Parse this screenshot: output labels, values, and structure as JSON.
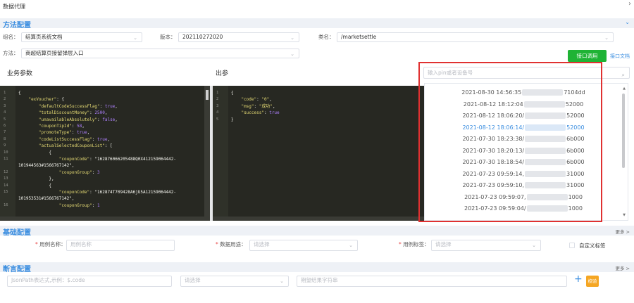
{
  "page_title": "数据代理",
  "sections": {
    "method": "方法配置",
    "base": "基础配置",
    "assert": "断言配置"
  },
  "form": {
    "group_label": "组名：",
    "group_value": "结算页系统文档",
    "version_label": "版本：",
    "version_value": "202110272020",
    "class_label": "类名：",
    "class_value": "/marketsettle",
    "method_label": "方法：",
    "method_value": "商超结算页接留弹层入口",
    "call_btn": "接口调用",
    "doc_link": "接口文档"
  },
  "params_title": "业务参数",
  "output_title": "出参",
  "search": {
    "placeholder": "输入pin或者设备号"
  },
  "dropdown_items": [
    {
      "time": "2021-08-30 14:56:35",
      "suffix": "7104dd",
      "active": false
    },
    {
      "time": "2021-08-12 18:12:04",
      "suffix": "52000",
      "active": false
    },
    {
      "time": "2021-08-12 18:06:20/",
      "suffix": "52000",
      "active": false
    },
    {
      "time": "2021-08-12 18:06:14/",
      "suffix": "52000",
      "active": true
    },
    {
      "time": "2021-07-30 18:23:38/",
      "suffix": "6b000",
      "active": false
    },
    {
      "time": "2021-07-30 18:20:13/",
      "suffix": "6b000",
      "active": false
    },
    {
      "time": "2021-07-30 18:18:54/",
      "suffix": "6b000",
      "active": false
    },
    {
      "time": "2021-07-23 09:59:14,",
      "suffix": "31000",
      "active": false
    },
    {
      "time": "2021-07-23 09:59:10,",
      "suffix": "31000",
      "active": false
    },
    {
      "time": "2021-07-23 09:59:07,",
      "suffix": "1000",
      "active": false
    },
    {
      "time": "2021-07-23 09:59:04/",
      "suffix": "1000",
      "active": false
    }
  ],
  "code_left": [
    {
      "n": "1",
      "t": "{"
    },
    {
      "n": "2",
      "t": "    \"exVoucher\": {"
    },
    {
      "n": "3",
      "t": "        \"defaultCodeSuccessFlag\": true,"
    },
    {
      "n": "4",
      "t": "        \"totalDiscountMoney\": 2500,"
    },
    {
      "n": "5",
      "t": "        \"unavailableAbsolutely\": false,"
    },
    {
      "n": "6",
      "t": "        \"couponTipId\": 58,"
    },
    {
      "n": "7",
      "t": "        \"promoteType\": true,"
    },
    {
      "n": "8",
      "t": "        \"codeListSuccessFlag\": true,"
    },
    {
      "n": "9",
      "t": "        \"actualSelectedCouponList\": ["
    },
    {
      "n": "10",
      "t": "            {"
    },
    {
      "n": "11",
      "t": "                \"couponCode\": \"162876066205488Q0X412159064442-"
    },
    {
      "n": "",
      "t": "101944563#1566767142\","
    },
    {
      "n": "12",
      "t": "                \"couponGroup\": 3"
    },
    {
      "n": "13",
      "t": "            },"
    },
    {
      "n": "14",
      "t": "            {"
    },
    {
      "n": "15",
      "t": "                \"couponCode\": \"162874T709428A6jU5A12159064442-"
    },
    {
      "n": "",
      "t": "101953531#1566767142\","
    },
    {
      "n": "16",
      "t": "                \"couponGroup\": 1"
    }
  ],
  "code_right": [
    {
      "n": "1",
      "t": "{"
    },
    {
      "n": "2",
      "t": "    \"code\": \"0\","
    },
    {
      "n": "3",
      "t": "    \"msg\": \"成功\","
    },
    {
      "n": "4",
      "t": "    \"success\": true"
    },
    {
      "n": "5",
      "t": "}"
    }
  ],
  "base": {
    "case_name_label": "用例名称：",
    "case_name_ph": "用例名称",
    "usage_label": "数据用途：",
    "usage_ph": "请选择",
    "tag_label": "用例标签：",
    "tag_ph": "请选择",
    "custom_tag": "自定义标签",
    "more": "更多 >"
  },
  "assert": {
    "jsonpath_ph": "JsonPath表达式,示例：$.code",
    "select_ph": "请选择",
    "expect_ph": "期望结果字符串",
    "verify_btn": "校验",
    "more": "更多 >"
  },
  "colors": {
    "accent": "#3b8ee0",
    "green": "#1fb335",
    "orange": "#f5a623",
    "red": "#e03131"
  }
}
